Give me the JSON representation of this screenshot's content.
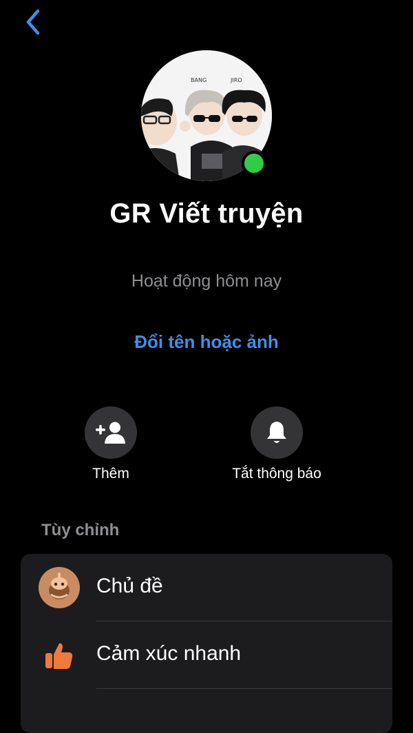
{
  "header": {
    "back_icon": "chevron-left-icon",
    "accent_color": "#3f8fe8"
  },
  "profile": {
    "avatar": {
      "labels": [
        "BANG",
        "JIRO"
      ]
    },
    "online": true,
    "presence_color": "#31cc46",
    "name": "GR Viết truyện",
    "status": "Hoạt động hôm nay",
    "rename_label": "Đổi tên hoặc ảnh"
  },
  "actions": [
    {
      "label": "Thêm",
      "icon": "add-person-icon"
    },
    {
      "label": "Tắt thông báo",
      "icon": "bell-icon"
    }
  ],
  "customize": {
    "title": "Tùy chỉnh",
    "items": [
      {
        "label": "Chủ đề",
        "icon": "theme-icon"
      },
      {
        "label": "Cảm xúc nhanh",
        "icon": "thumbs-up-icon"
      }
    ]
  }
}
